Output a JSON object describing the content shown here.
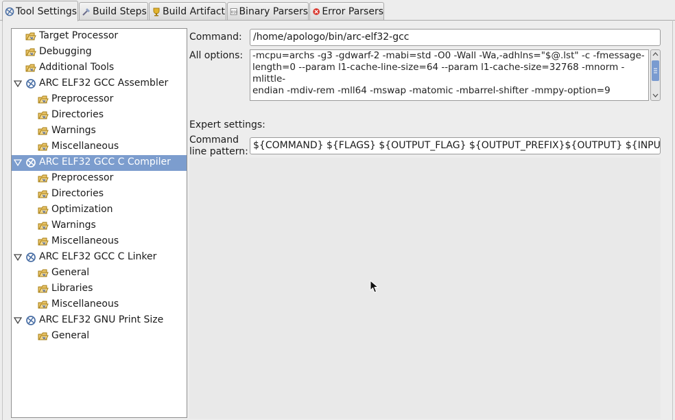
{
  "tabs": [
    {
      "label": "Tool Settings",
      "icon": "tool-settings-icon",
      "active": true
    },
    {
      "label": "Build Steps",
      "icon": "build-steps-icon",
      "active": false
    },
    {
      "label": "Build Artifact",
      "icon": "build-artifact-icon",
      "active": false
    },
    {
      "label": "Binary Parsers",
      "icon": "binary-parsers-icon",
      "active": false
    },
    {
      "label": "Error Parsers",
      "icon": "error-parsers-icon",
      "active": false
    }
  ],
  "tree": {
    "items": [
      {
        "label": "Target Processor",
        "level": 1,
        "icon": "folder-icon"
      },
      {
        "label": "Debugging",
        "level": 1,
        "icon": "folder-icon"
      },
      {
        "label": "Additional Tools",
        "level": 1,
        "icon": "folder-icon"
      },
      {
        "label": "ARC ELF32 GCC Assembler",
        "level": 0,
        "icon": "tool-icon",
        "expanded": true
      },
      {
        "label": "Preprocessor",
        "level": 2,
        "icon": "folder-icon"
      },
      {
        "label": "Directories",
        "level": 2,
        "icon": "folder-icon"
      },
      {
        "label": "Warnings",
        "level": 2,
        "icon": "folder-icon"
      },
      {
        "label": "Miscellaneous",
        "level": 2,
        "icon": "folder-icon"
      },
      {
        "label": "ARC ELF32 GCC C Compiler",
        "level": 0,
        "icon": "tool-icon",
        "expanded": true,
        "selected": true
      },
      {
        "label": "Preprocessor",
        "level": 2,
        "icon": "folder-icon"
      },
      {
        "label": "Directories",
        "level": 2,
        "icon": "folder-icon"
      },
      {
        "label": "Optimization",
        "level": 2,
        "icon": "folder-icon"
      },
      {
        "label": "Warnings",
        "level": 2,
        "icon": "folder-icon"
      },
      {
        "label": "Miscellaneous",
        "level": 2,
        "icon": "folder-icon"
      },
      {
        "label": "ARC ELF32 GCC C Linker",
        "level": 0,
        "icon": "tool-icon",
        "expanded": true
      },
      {
        "label": "General",
        "level": 2,
        "icon": "folder-icon"
      },
      {
        "label": "Libraries",
        "level": 2,
        "icon": "folder-icon"
      },
      {
        "label": "Miscellaneous",
        "level": 2,
        "icon": "folder-icon"
      },
      {
        "label": "ARC ELF32 GNU Print Size",
        "level": 0,
        "icon": "tool-icon",
        "expanded": true
      },
      {
        "label": "General",
        "level": 2,
        "icon": "folder-icon"
      }
    ]
  },
  "settings": {
    "command_label": "Command:",
    "command_value": "/home/apologo/bin/arc-elf32-gcc",
    "all_options_label": "All options:",
    "all_options_lines": [
      "-mcpu=archs -g3 -gdwarf-2 -mabi=std -O0 -Wall -Wa,-adhlns=\"$@.lst\" -c -fmessage-",
      "length=0 --param l1-cache-line-size=64 --param l1-cache-size=32768 -mnorm -mlittle-",
      "endian -mdiv-rem -mll64 -mswap -matomic -mbarrel-shifter -mmpy-option=9"
    ],
    "expert_label": "Expert settings:",
    "pattern_label_line1": "Command",
    "pattern_label_line2": "line pattern:",
    "pattern_value": "${COMMAND} ${FLAGS} ${OUTPUT_FLAG} ${OUTPUT_PREFIX}${OUTPUT} ${INPUTS}"
  },
  "colors": {
    "selection": "#7c9dce",
    "scroll_thumb": "#7a9bd0"
  }
}
